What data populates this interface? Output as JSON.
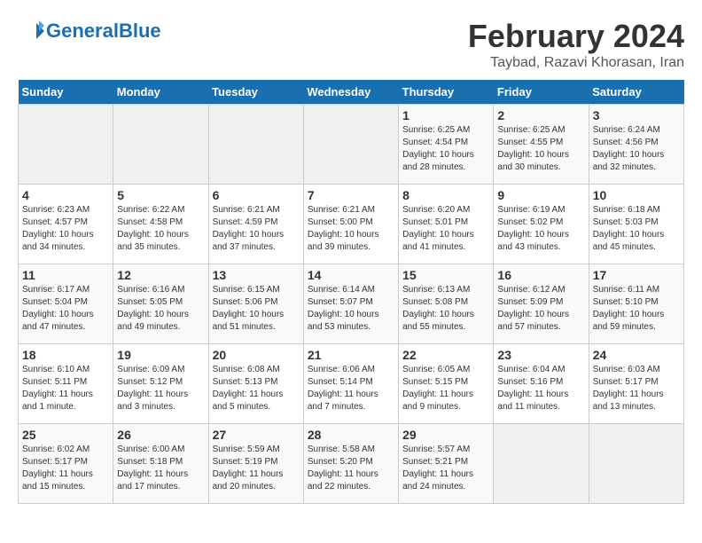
{
  "header": {
    "logo_general": "General",
    "logo_blue": "Blue",
    "month_title": "February 2024",
    "location": "Taybad, Razavi Khorasan, Iran"
  },
  "days_of_week": [
    "Sunday",
    "Monday",
    "Tuesday",
    "Wednesday",
    "Thursday",
    "Friday",
    "Saturday"
  ],
  "weeks": [
    [
      {
        "day": "",
        "sunrise": "",
        "sunset": "",
        "daylight": "",
        "empty": true
      },
      {
        "day": "",
        "sunrise": "",
        "sunset": "",
        "daylight": "",
        "empty": true
      },
      {
        "day": "",
        "sunrise": "",
        "sunset": "",
        "daylight": "",
        "empty": true
      },
      {
        "day": "",
        "sunrise": "",
        "sunset": "",
        "daylight": "",
        "empty": true
      },
      {
        "day": "1",
        "sunrise": "Sunrise: 6:25 AM",
        "sunset": "Sunset: 4:54 PM",
        "daylight": "Daylight: 10 hours and 28 minutes."
      },
      {
        "day": "2",
        "sunrise": "Sunrise: 6:25 AM",
        "sunset": "Sunset: 4:55 PM",
        "daylight": "Daylight: 10 hours and 30 minutes."
      },
      {
        "day": "3",
        "sunrise": "Sunrise: 6:24 AM",
        "sunset": "Sunset: 4:56 PM",
        "daylight": "Daylight: 10 hours and 32 minutes."
      }
    ],
    [
      {
        "day": "4",
        "sunrise": "Sunrise: 6:23 AM",
        "sunset": "Sunset: 4:57 PM",
        "daylight": "Daylight: 10 hours and 34 minutes."
      },
      {
        "day": "5",
        "sunrise": "Sunrise: 6:22 AM",
        "sunset": "Sunset: 4:58 PM",
        "daylight": "Daylight: 10 hours and 35 minutes."
      },
      {
        "day": "6",
        "sunrise": "Sunrise: 6:21 AM",
        "sunset": "Sunset: 4:59 PM",
        "daylight": "Daylight: 10 hours and 37 minutes."
      },
      {
        "day": "7",
        "sunrise": "Sunrise: 6:21 AM",
        "sunset": "Sunset: 5:00 PM",
        "daylight": "Daylight: 10 hours and 39 minutes."
      },
      {
        "day": "8",
        "sunrise": "Sunrise: 6:20 AM",
        "sunset": "Sunset: 5:01 PM",
        "daylight": "Daylight: 10 hours and 41 minutes."
      },
      {
        "day": "9",
        "sunrise": "Sunrise: 6:19 AM",
        "sunset": "Sunset: 5:02 PM",
        "daylight": "Daylight: 10 hours and 43 minutes."
      },
      {
        "day": "10",
        "sunrise": "Sunrise: 6:18 AM",
        "sunset": "Sunset: 5:03 PM",
        "daylight": "Daylight: 10 hours and 45 minutes."
      }
    ],
    [
      {
        "day": "11",
        "sunrise": "Sunrise: 6:17 AM",
        "sunset": "Sunset: 5:04 PM",
        "daylight": "Daylight: 10 hours and 47 minutes."
      },
      {
        "day": "12",
        "sunrise": "Sunrise: 6:16 AM",
        "sunset": "Sunset: 5:05 PM",
        "daylight": "Daylight: 10 hours and 49 minutes."
      },
      {
        "day": "13",
        "sunrise": "Sunrise: 6:15 AM",
        "sunset": "Sunset: 5:06 PM",
        "daylight": "Daylight: 10 hours and 51 minutes."
      },
      {
        "day": "14",
        "sunrise": "Sunrise: 6:14 AM",
        "sunset": "Sunset: 5:07 PM",
        "daylight": "Daylight: 10 hours and 53 minutes."
      },
      {
        "day": "15",
        "sunrise": "Sunrise: 6:13 AM",
        "sunset": "Sunset: 5:08 PM",
        "daylight": "Daylight: 10 hours and 55 minutes."
      },
      {
        "day": "16",
        "sunrise": "Sunrise: 6:12 AM",
        "sunset": "Sunset: 5:09 PM",
        "daylight": "Daylight: 10 hours and 57 minutes."
      },
      {
        "day": "17",
        "sunrise": "Sunrise: 6:11 AM",
        "sunset": "Sunset: 5:10 PM",
        "daylight": "Daylight: 10 hours and 59 minutes."
      }
    ],
    [
      {
        "day": "18",
        "sunrise": "Sunrise: 6:10 AM",
        "sunset": "Sunset: 5:11 PM",
        "daylight": "Daylight: 11 hours and 1 minute."
      },
      {
        "day": "19",
        "sunrise": "Sunrise: 6:09 AM",
        "sunset": "Sunset: 5:12 PM",
        "daylight": "Daylight: 11 hours and 3 minutes."
      },
      {
        "day": "20",
        "sunrise": "Sunrise: 6:08 AM",
        "sunset": "Sunset: 5:13 PM",
        "daylight": "Daylight: 11 hours and 5 minutes."
      },
      {
        "day": "21",
        "sunrise": "Sunrise: 6:06 AM",
        "sunset": "Sunset: 5:14 PM",
        "daylight": "Daylight: 11 hours and 7 minutes."
      },
      {
        "day": "22",
        "sunrise": "Sunrise: 6:05 AM",
        "sunset": "Sunset: 5:15 PM",
        "daylight": "Daylight: 11 hours and 9 minutes."
      },
      {
        "day": "23",
        "sunrise": "Sunrise: 6:04 AM",
        "sunset": "Sunset: 5:16 PM",
        "daylight": "Daylight: 11 hours and 11 minutes."
      },
      {
        "day": "24",
        "sunrise": "Sunrise: 6:03 AM",
        "sunset": "Sunset: 5:17 PM",
        "daylight": "Daylight: 11 hours and 13 minutes."
      }
    ],
    [
      {
        "day": "25",
        "sunrise": "Sunrise: 6:02 AM",
        "sunset": "Sunset: 5:17 PM",
        "daylight": "Daylight: 11 hours and 15 minutes."
      },
      {
        "day": "26",
        "sunrise": "Sunrise: 6:00 AM",
        "sunset": "Sunset: 5:18 PM",
        "daylight": "Daylight: 11 hours and 17 minutes."
      },
      {
        "day": "27",
        "sunrise": "Sunrise: 5:59 AM",
        "sunset": "Sunset: 5:19 PM",
        "daylight": "Daylight: 11 hours and 20 minutes."
      },
      {
        "day": "28",
        "sunrise": "Sunrise: 5:58 AM",
        "sunset": "Sunset: 5:20 PM",
        "daylight": "Daylight: 11 hours and 22 minutes."
      },
      {
        "day": "29",
        "sunrise": "Sunrise: 5:57 AM",
        "sunset": "Sunset: 5:21 PM",
        "daylight": "Daylight: 11 hours and 24 minutes."
      },
      {
        "day": "",
        "sunrise": "",
        "sunset": "",
        "daylight": "",
        "empty": true
      },
      {
        "day": "",
        "sunrise": "",
        "sunset": "",
        "daylight": "",
        "empty": true
      }
    ]
  ]
}
